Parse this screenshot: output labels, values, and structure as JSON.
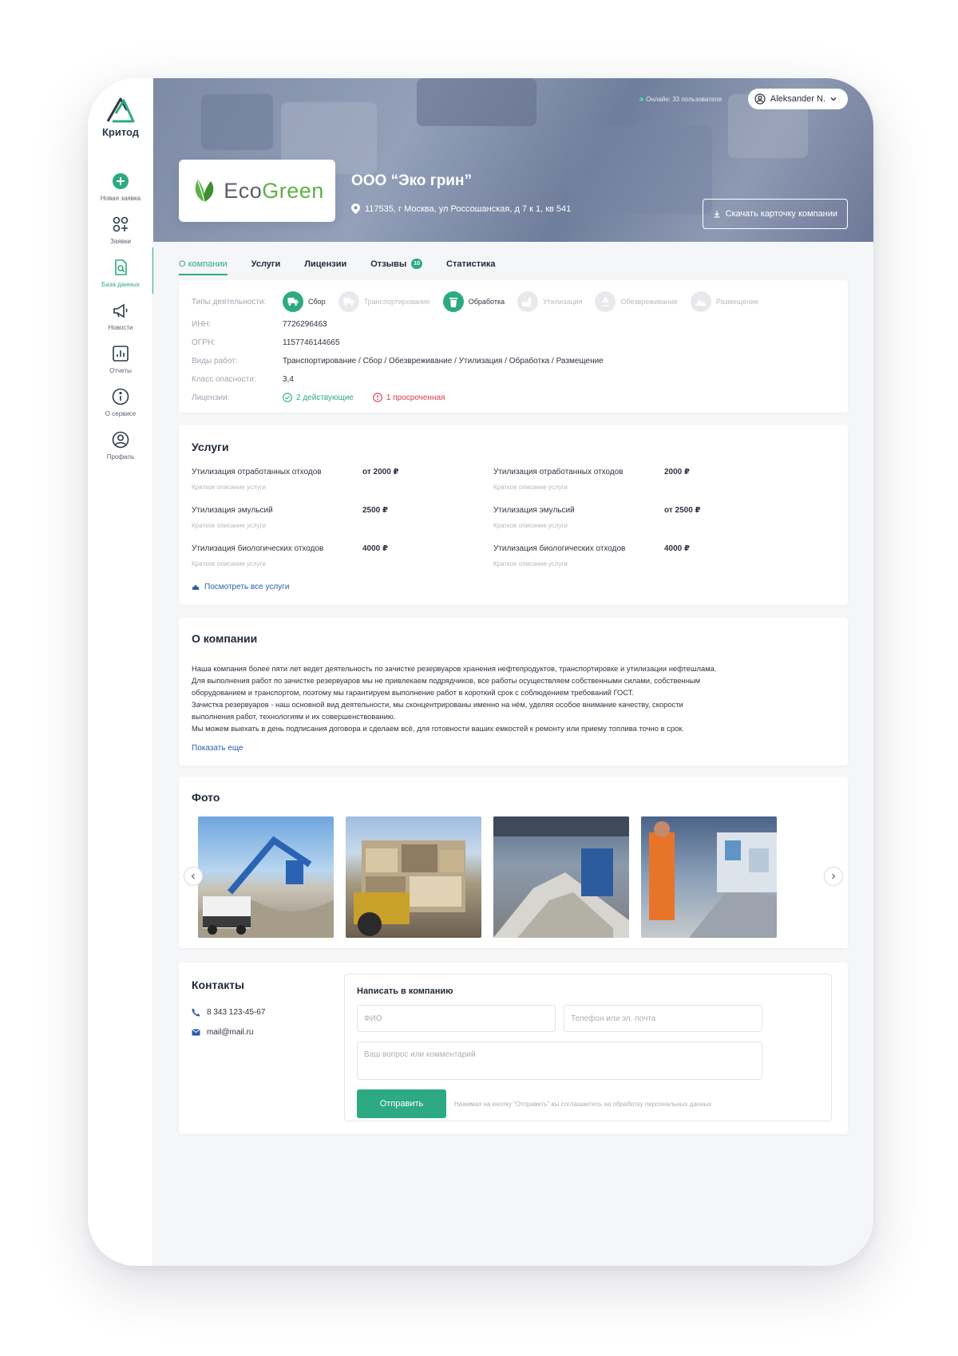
{
  "app": {
    "logo_text": "Критод"
  },
  "sidebar": {
    "items": [
      {
        "label": "Новая заявка",
        "icon": "plus-circle-icon"
      },
      {
        "label": "Заявки",
        "icon": "grid-plus-icon"
      },
      {
        "label": "База данных",
        "icon": "document-search-icon"
      },
      {
        "label": "Новости",
        "icon": "megaphone-icon"
      },
      {
        "label": "Отчеты",
        "icon": "chart-icon"
      },
      {
        "label": "О сервисе",
        "icon": "info-icon"
      },
      {
        "label": "Профиль",
        "icon": "user-icon"
      }
    ]
  },
  "header": {
    "online": "Онлайн: 33 пользователя",
    "user_name": "Aleksander N.",
    "company_name": "ООО “Эко грин”",
    "company_address": "117535, г Москва, ул Россошанская, д 7 к 1, кв 541",
    "download_label": "Скачать карточку компании",
    "logo_eco": "Eco",
    "logo_green": "Green"
  },
  "tabs": [
    {
      "label": "О компании",
      "active": true
    },
    {
      "label": "Услуги"
    },
    {
      "label": "Лицензии"
    },
    {
      "label": "Отзывы",
      "badge": "10"
    },
    {
      "label": "Статистика"
    }
  ],
  "info": {
    "activities_label": "Типы деятельности:",
    "activities": [
      {
        "label": "Сбор",
        "active": true
      },
      {
        "label": "Транспортирование",
        "active": false
      },
      {
        "label": "Обработка",
        "active": true
      },
      {
        "label": "Утилизация",
        "active": false
      },
      {
        "label": "Обезвреживание",
        "active": false
      },
      {
        "label": "Размещение",
        "active": false
      }
    ],
    "inn_label": "ИНН:",
    "inn": "7726296463",
    "ogrn_label": "ОГРН:",
    "ogrn": "1157746144665",
    "works_label": "Виды работ:",
    "works": "Транспортирование / Сбор / Обезвреживание / Утилизация / Обработка / Размещение",
    "hazard_label": "Класс опасности:",
    "hazard": "3,4",
    "licenses_label": "Лицензии:",
    "licenses_ok": "2 действующие",
    "licenses_bad": "1 просроченная"
  },
  "services": {
    "title": "Услуги",
    "items": [
      {
        "name": "Утилизация отработанных отходов",
        "desc": "Краткое описание услуги",
        "price": "от 2000 ₽"
      },
      {
        "name": "Утилизация отработанных отходов",
        "desc": "Краткое описание услуги",
        "price": "2000 ₽"
      },
      {
        "name": "Утилизация эмульсий",
        "desc": "Краткое описание услуги",
        "price": "2500 ₽"
      },
      {
        "name": "Утилизация эмульсий",
        "desc": "Краткое описание услуги",
        "price": "от 2500 ₽"
      },
      {
        "name": "Утилизация биологических отходов",
        "desc": "Краткое описание услуги",
        "price": "4000 ₽"
      },
      {
        "name": "Утилизация биологических отходов",
        "desc": "Краткое описание услуги",
        "price": "4000 ₽"
      }
    ],
    "link": "Посмотреть все услуги"
  },
  "about": {
    "title": "О компании",
    "lines": [
      "Наша компания более пяти лет ведет деятельность по зачистке резервуаров хранения нефтепродуктов, транспортировке и утилизации нефтешлама.",
      "Для выполнения работ по зачистке резервуаров мы не привлекаем подрядчиков, все работы осуществляем собственными силами, собственным",
      "оборудованием и транспортом, поэтому мы гарантируем выполнение работ в короткий срок с соблюдением требований ГОСТ.",
      "Зачистка резервуаров - наш основной вид деятельности, мы сконцентрированы именно на нём, уделяя особое внимание качеству, скорости",
      "выполнения работ, технологиям и их совершенствованию.",
      "Мы можем выехать в день подписания договора и сделаем всё, для готовности ваших емкостей к ремонту или приему топлива точно в срок."
    ],
    "more": "Показать еще"
  },
  "photos": {
    "title": "Фото"
  },
  "contacts": {
    "title": "Контакты",
    "phone": "8 343 123-45-67",
    "email": "mail@mail.ru",
    "form_title": "Написать в компанию",
    "name_placeholder": "ФИО",
    "contact_placeholder": "Телефон или эл. почта",
    "message_placeholder": "Ваш вопрос или комментарий",
    "submit": "Отправить",
    "agree": "Нажимая на кнопку “Отправить” вы соглашаетесь на обработку персональных данных"
  },
  "colors": {
    "accent": "#2eaa82",
    "link": "#2a5ea8",
    "danger": "#e23a4a"
  }
}
